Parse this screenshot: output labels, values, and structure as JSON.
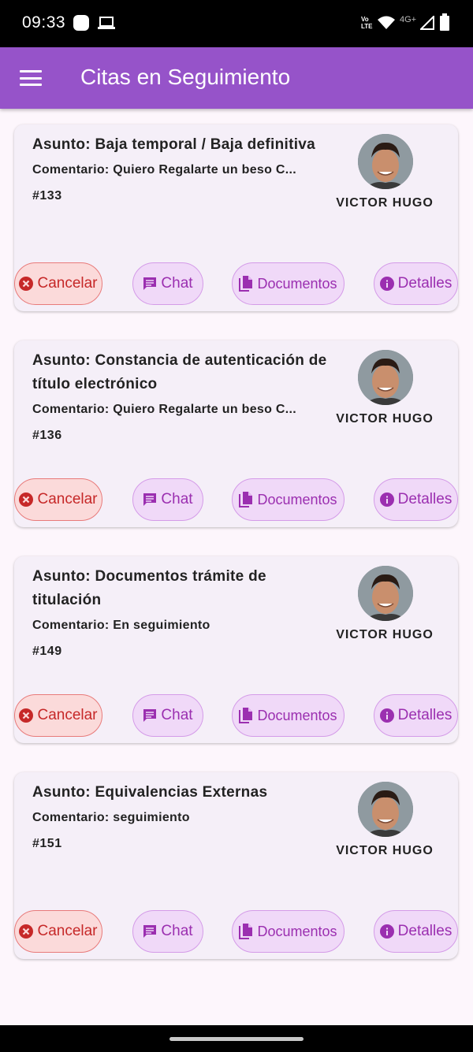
{
  "status_bar": {
    "time": "09:33",
    "network": "4G+",
    "volte": "Vo\nLTE"
  },
  "app_bar": {
    "title": "Citas en Seguimiento",
    "menu_icon": "hamburger-menu-icon"
  },
  "colors": {
    "app_bar": "#9653c9",
    "cancel": "#c62828",
    "action": "#9b2fb0",
    "background": "#fdf6fc"
  },
  "buttons": {
    "cancel": "Cancelar",
    "chat": "Chat",
    "documents": "Documentos",
    "details": "Detalles"
  },
  "cards": [
    {
      "subject": "Asunto: Baja temporal / Baja definitiva",
      "comment": "Comentario: Quiero Regalarte un beso C...",
      "id": "#133",
      "agent": "VICTOR HUGO"
    },
    {
      "subject": "Asunto: Constancia de autenticación de título electrónico",
      "comment": "Comentario: Quiero Regalarte un beso C...",
      "id": "#136",
      "agent": "VICTOR HUGO"
    },
    {
      "subject": "Asunto: Documentos trámite de titulación",
      "comment": "Comentario: En seguimiento",
      "id": "#149",
      "agent": "VICTOR HUGO"
    },
    {
      "subject": "Asunto: Equivalencias Externas",
      "comment": "Comentario: seguimiento",
      "id": "#151",
      "agent": "VICTOR HUGO"
    }
  ]
}
